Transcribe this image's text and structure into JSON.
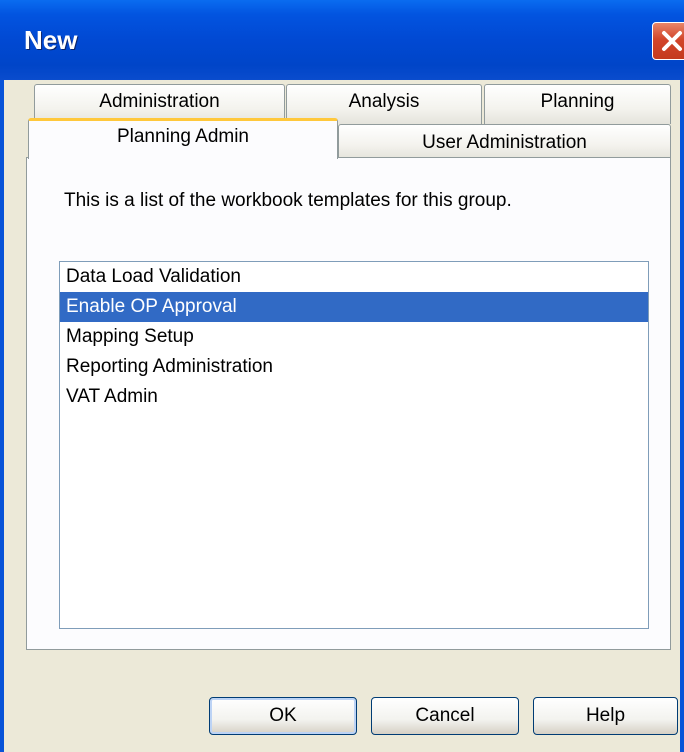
{
  "window": {
    "title": "New"
  },
  "tabs": {
    "row_back": [
      "Administration",
      "Analysis",
      "Planning"
    ],
    "row_front": [
      "Planning Admin",
      "User Administration"
    ],
    "active": "Planning Admin"
  },
  "panel": {
    "description": "This is a list of the workbook templates for this group."
  },
  "list": {
    "items": [
      "Data Load Validation",
      "Enable OP Approval",
      "Mapping Setup",
      "Reporting Administration",
      "VAT Admin"
    ],
    "selected": "Enable OP Approval"
  },
  "buttons": {
    "ok": "OK",
    "cancel": "Cancel",
    "help": "Help"
  },
  "colors": {
    "titlebar": "#0054e3",
    "selection": "#316ac5",
    "active_tab_accent": "#ffc83c",
    "close_button": "#d2462b"
  },
  "icons": {
    "close": "close-icon"
  }
}
